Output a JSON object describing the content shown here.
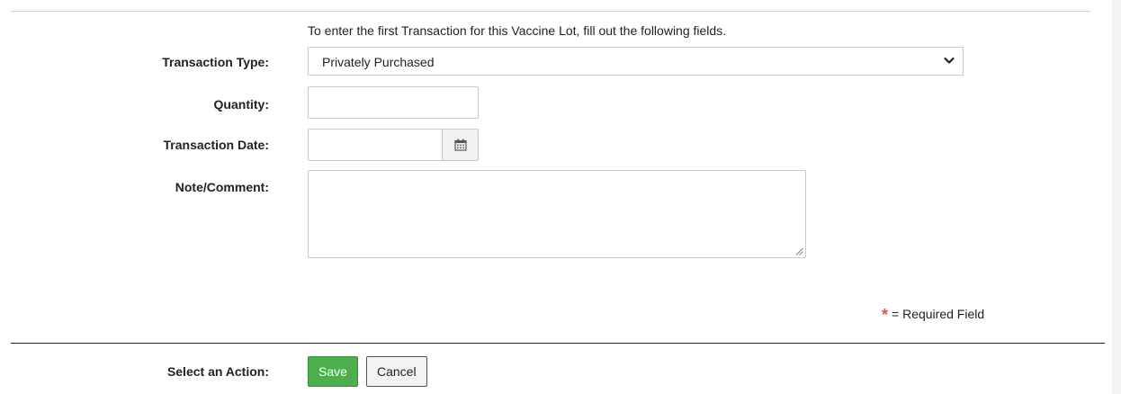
{
  "form": {
    "intro_text": "To enter the first Transaction for this Vaccine Lot, fill out the following fields.",
    "transaction_type": {
      "label": "Transaction Type:",
      "selected": "Privately Purchased"
    },
    "quantity": {
      "label": "Quantity:",
      "value": ""
    },
    "transaction_date": {
      "label": "Transaction Date:",
      "value": "",
      "icon": "calendar-icon"
    },
    "note": {
      "label": "Note/Comment:",
      "value": ""
    },
    "required_legend": {
      "marker": "*",
      "text": "= Required Field",
      "marker_color": "#d9534f"
    }
  },
  "actions": {
    "label": "Select an Action:",
    "save_label": "Save",
    "cancel_label": "Cancel",
    "save_color": "#4cae4c"
  }
}
